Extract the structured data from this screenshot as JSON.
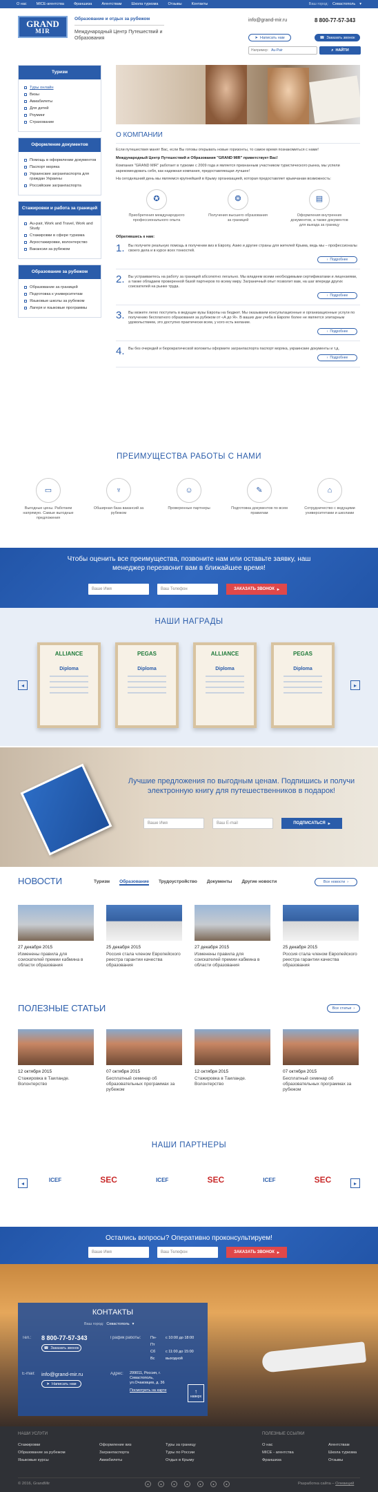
{
  "topbar": {
    "nav": [
      "О нас",
      "MICE-агентства",
      "Франшиза",
      "Агентствам",
      "Школа туризма",
      "Отзывы",
      "Контакты"
    ],
    "city_label": "Ваш город:",
    "city": "Севастополь"
  },
  "header": {
    "logo_line1": "GRAND",
    "logo_line2": "MIR",
    "title": "Образование и отдых за рубежом",
    "subtitle": "Международный Центр Путешествий и Образования",
    "email": "info@grand-mir.ru",
    "phone": "8 800-77-57-343",
    "write_btn": "Написать нам",
    "call_btn": "Заказать звонок",
    "search_label": "Например:",
    "search_value": "Au-Pair",
    "find_btn": "НАЙТИ"
  },
  "sidebar": [
    {
      "title": "Туризм",
      "items": [
        "Туры онлайн",
        "Визы",
        "Авиабилеты",
        "Для детей",
        "Роуминг",
        "Страхование"
      ]
    },
    {
      "title": "Оформление документов",
      "items": [
        "Помощь в оформлении документов",
        "Паспорт моряка",
        "Украинские загранпаспорта для граждан Украины",
        "Российские загранпаспорта"
      ]
    },
    {
      "title": "Стажировки и работа за границей",
      "items": [
        "Au-pair, Work and Travel, Work and Study",
        "Стажировки в сфере туризма",
        "Агростажировки, волонтерство",
        "Вакансии за рубежом"
      ]
    },
    {
      "title": "Образование за рубежом",
      "items": [
        "Образование за границей",
        "Подготовка к университетам",
        "Языковые школы за рубежом",
        "Лагеря и языковые программы"
      ]
    }
  ],
  "about": {
    "title": "О КОМПАНИИ",
    "p1": "Если путешествия манят Вас, если Вы готовы открывать новые горизонты, то самое время познакомиться с нами!",
    "p2": "Международный Центр Путешествий и Образования \"GRAND MIR\" приветствует Вас!",
    "p3": "Компания \"GRAND MIR\" работает в туризме с 2009 года и является признанным участником туристического рынка, мы успели зарекомендовать себя, как надежная компания, предоставляющая лучшее!",
    "p4": "На сегодняшний день мы являемся крупнейшей в Крыму организацией, которая предоставляет крымчанам возможность:",
    "features": [
      "Приобретения международного профессионального опыта",
      "Получения высшего образования за границей",
      "Оформления внутренних документов, а также документов для выезда за границу"
    ],
    "contact_hdr": "Обратившись к нам:",
    "steps": [
      {
        "n": "1.",
        "text": "Вы получите реальную помощь в получении виз в Европу, Азию и другие страны для жителей Крыма, ведь мы – профессионалы своего дела и в курсе всех тонкостей."
      },
      {
        "n": "2.",
        "text": "Вы устраиваетесь на работу за границей абсолютно легально. Мы владеем всеми необходимыми сертификатами и лицензиями, а также обладаем проверенной базой партнеров по всему миру. Заграничный опыт позволит вам, на шаг впереди других соискателей на рынке труда."
      },
      {
        "n": "3.",
        "text": "Вы можете легко поступить в ведущие вузы Европы на бюджет. Мы оказываем консультационные и организационные услуги по получению бесплатного образования за рубежом от «А до Я». В ваших дни учеба в Европе более не является элитарным удовольствием, это доступно практически всем, у кого есть желание."
      },
      {
        "n": "4.",
        "text": "Вы без очередей и бюрократической волокиты оформите загранпаспорта паспорт моряка, украинские документы и т.д."
      }
    ],
    "more": "Подробнее"
  },
  "advantages": {
    "title": "ПРЕИМУЩЕСТВА РАБОТЫ С НАМИ",
    "items": [
      "Выгодные цены. Работаем напрямую. Самые выгодные предложения",
      "Обширная база вакансий за рубежом",
      "Проверенные партнеры",
      "Подготовка документов по всем правилам",
      "Сотрудничество с ведущими университетами и школами"
    ]
  },
  "cta1": {
    "text": "Чтобы оценить все преимущества, позвоните нам или оставьте заявку, наш менеджер перезвонит вам в ближайшее время!",
    "name_ph": "Ваше Имя",
    "phone_ph": "Ваш Телефон",
    "btn": "ЗАКАЗАТЬ ЗВОНОК"
  },
  "awards": {
    "title": "НАШИ НАГРАДЫ",
    "diplomas": [
      "Diploma",
      "Diploma",
      "Diploma",
      "Diploma"
    ],
    "brands": [
      "ALLIANCE",
      "PEGAS",
      "ALLIANCE",
      "PEGAS"
    ]
  },
  "subscribe": {
    "text": "Лучшие предложения по выгодным ценам. Подпишись и получи электронную книгу для путешественников в подарок!",
    "name_ph": "Ваше Имя",
    "email_ph": "Ваш E-mail",
    "btn": "ПОДПИСАТЬСЯ"
  },
  "news": {
    "title": "НОВОСТИ",
    "tabs": [
      "Туризм",
      "Образование",
      "Трудоустройство",
      "Документы",
      "Другие новости"
    ],
    "all_btn": "Все новости",
    "items": [
      {
        "date": "27 декабря 2015",
        "title": "Изменены правила для соискателей премии кабмина в области образования"
      },
      {
        "date": "25 декабря 2015",
        "title": "Россия стала членом Европейского реестра гарантии качества образования"
      },
      {
        "date": "27 декабря 2015",
        "title": "Изменены правила для соискателей премии кабмина в области образования"
      },
      {
        "date": "25 декабря 2015",
        "title": "Россия стала членом Европейского реестра гарантии качества образования"
      }
    ]
  },
  "articles": {
    "title": "ПОЛЕЗНЫЕ СТАТЬИ",
    "all_btn": "Все статьи",
    "items": [
      {
        "date": "12 октября 2015",
        "title": "Стажировка в Таиланде. Волонтерство"
      },
      {
        "date": "07 октября 2015",
        "title": "Бесплатный семинар об образовательных программах за рубежом"
      },
      {
        "date": "12 октября 2015",
        "title": "Стажировка в Таиланде. Волонтерство"
      },
      {
        "date": "07 октября 2015",
        "title": "Бесплатный семинар об образовательных программах за рубежом"
      }
    ]
  },
  "partners": {
    "title": "НАШИ ПАРТНЕРЫ",
    "logos": [
      "ICEF",
      "SEC",
      "ICEF",
      "SEC",
      "ICEF",
      "SEC"
    ]
  },
  "cta2": {
    "text": "Остались вопросы? Оперативно проконсультируем!",
    "name_ph": "Ваше Имя",
    "phone_ph": "Ваш Телефон",
    "btn": "ЗАКАЗАТЬ ЗВОНОК"
  },
  "contacts": {
    "title": "КОНТАКТЫ",
    "city_label": "Ваш город:",
    "city": "Севастополь",
    "tel_label": "Тел.:",
    "phone": "8 800-77-57-343",
    "call": "Заказать звонок",
    "schedule_label": "График работы:",
    "schedule": [
      [
        "Пн-Пт",
        "с 10:00 до 18:00"
      ],
      [
        "Сб",
        "с 11:00 до 15:00"
      ],
      [
        "Вс",
        "выходной"
      ]
    ],
    "email_label": "E-mail:",
    "email": "info@grand-mir.ru",
    "write": "Написать нам",
    "addr_label": "Адрес:",
    "address": "299011, Россия, г. Севастополь, ул.Очаковцев, д. 36",
    "map_link": "Посмотреть на карте",
    "up": "наверх"
  },
  "footer": {
    "services_title": "НАШИ УСЛУГИ",
    "links_title": "ПОЛЕЗНЫЕ ССЫЛКИ",
    "col1": [
      "Стажировки",
      "Образование за рубежом",
      "Языковые курсы"
    ],
    "col2": [
      "Оформление виз",
      "Загранпаспорта",
      "Авиабилеты"
    ],
    "col3": [
      "Туры за границу",
      "Туры по России",
      "Отдых в Крыму"
    ],
    "col4": [
      "О нас",
      "MICE - агентства",
      "Франшиза"
    ],
    "col5": [
      "Агентствам",
      "Школа туризма",
      "Отзывы"
    ],
    "copyright": "© 2016, GrandMir",
    "dev": "Разработка сайта –",
    "dev_name": "Олевиций"
  }
}
